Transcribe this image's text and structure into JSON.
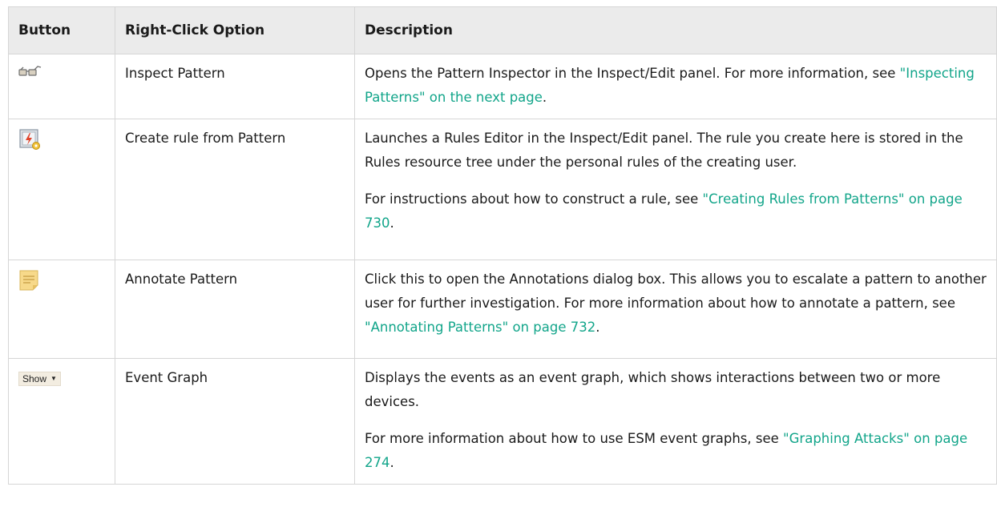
{
  "headers": {
    "button": "Button",
    "option": "Right-Click Option",
    "description": "Description"
  },
  "rows": [
    {
      "icon": "glasses-icon",
      "option": "Inspect Pattern",
      "description": {
        "text": "Opens the Pattern Inspector in the Inspect/Edit panel. For more information, see ",
        "link": "\"Inspecting Patterns\" on the next page",
        "tail": "."
      }
    },
    {
      "icon": "rule-icon",
      "option": "Create rule from Pattern",
      "description": {
        "text": "Launches a Rules Editor in the Inspect/Edit panel. The rule you create here is stored in the Rules resource tree under the personal rules of the creating user.",
        "text2": "For instructions about how to construct a rule, see ",
        "link": "\"Creating Rules from Patterns\" on page 730",
        "tail": "."
      }
    },
    {
      "icon": "note-icon",
      "option": "Annotate Pattern",
      "description": {
        "text": "Click this to open the Annotations dialog box. This allows you to escalate a pattern to another user for further investigation. For more information about how to annotate a pattern, see ",
        "link": "\"Annotating Patterns\" on page 732",
        "tail": "."
      }
    },
    {
      "icon": "dropdown-caret-icon",
      "button_label": "Show",
      "option": "Event Graph",
      "description": {
        "text": "Displays the events as an event graph, which shows interactions between two or more devices.",
        "text2": "For more information about how to use ESM event graphs, see ",
        "link": "\"Graphing Attacks\" on page 274",
        "tail": "."
      }
    }
  ],
  "colors": {
    "link": "#12a58a",
    "header_bg": "#ebebeb",
    "border": "#d6d6d6"
  }
}
